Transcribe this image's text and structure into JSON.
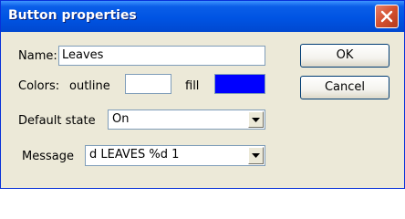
{
  "window": {
    "title": "Button properties"
  },
  "form": {
    "name_label": "Name:",
    "name_value": "Leaves",
    "colors_label": "Colors:",
    "outline_label": "outline",
    "fill_label": "fill",
    "outline_color": "#ffffff",
    "fill_color": "#0000ff",
    "default_state_label": "Default state",
    "default_state_value": "On",
    "message_label": "Message",
    "message_value": "d LEAVES %d 1"
  },
  "buttons": {
    "ok": "OK",
    "cancel": "Cancel"
  }
}
